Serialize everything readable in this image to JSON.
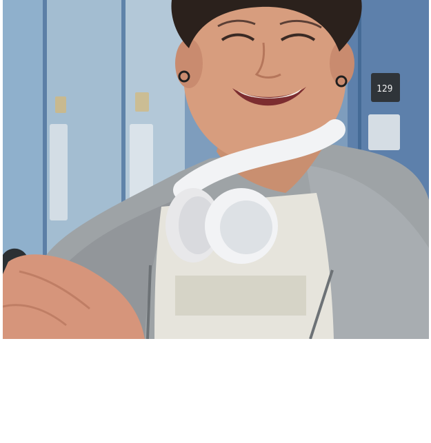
{
  "photo": {
    "alt": "",
    "locker_number": "129",
    "colors": {
      "locker_blue": "#6f8fb2",
      "locker_light": "#b9cad8",
      "hoodie_gray": "#9ea3a6",
      "headphones_white": "#f2f3f5",
      "shirt_white": "#e6e4dc",
      "skin": "#d79d7e",
      "hair": "#2b211c"
    }
  },
  "blank_area": {
    "color": "#ffffff"
  }
}
